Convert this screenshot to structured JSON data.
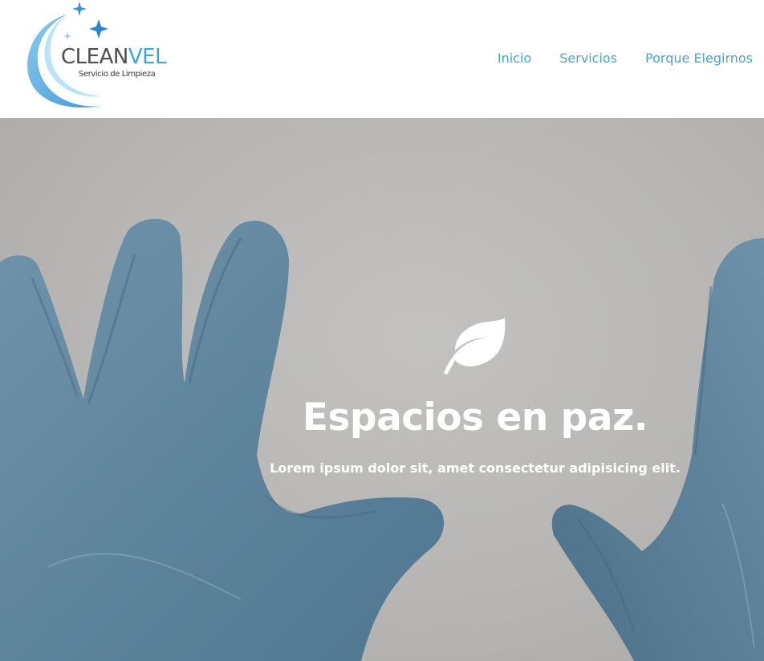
{
  "brand": {
    "name_part1": "CLEAN",
    "name_part2": "VEL",
    "tagline": "Servicio de Limpieza"
  },
  "nav": {
    "items": [
      {
        "label": "Inicio"
      },
      {
        "label": "Servicios"
      },
      {
        "label": "Porque Elegirnos"
      }
    ]
  },
  "hero": {
    "icon": "leaf-icon",
    "title": "Espacios en paz.",
    "subtitle": "Lorem ipsum dolor sit, amet consectetur adipisicing elit."
  },
  "colors": {
    "accent": "#4aa3d6",
    "brand_dark": "#4e4f52",
    "hero_bg": "#bdbcba",
    "glove": "#5f849c"
  }
}
